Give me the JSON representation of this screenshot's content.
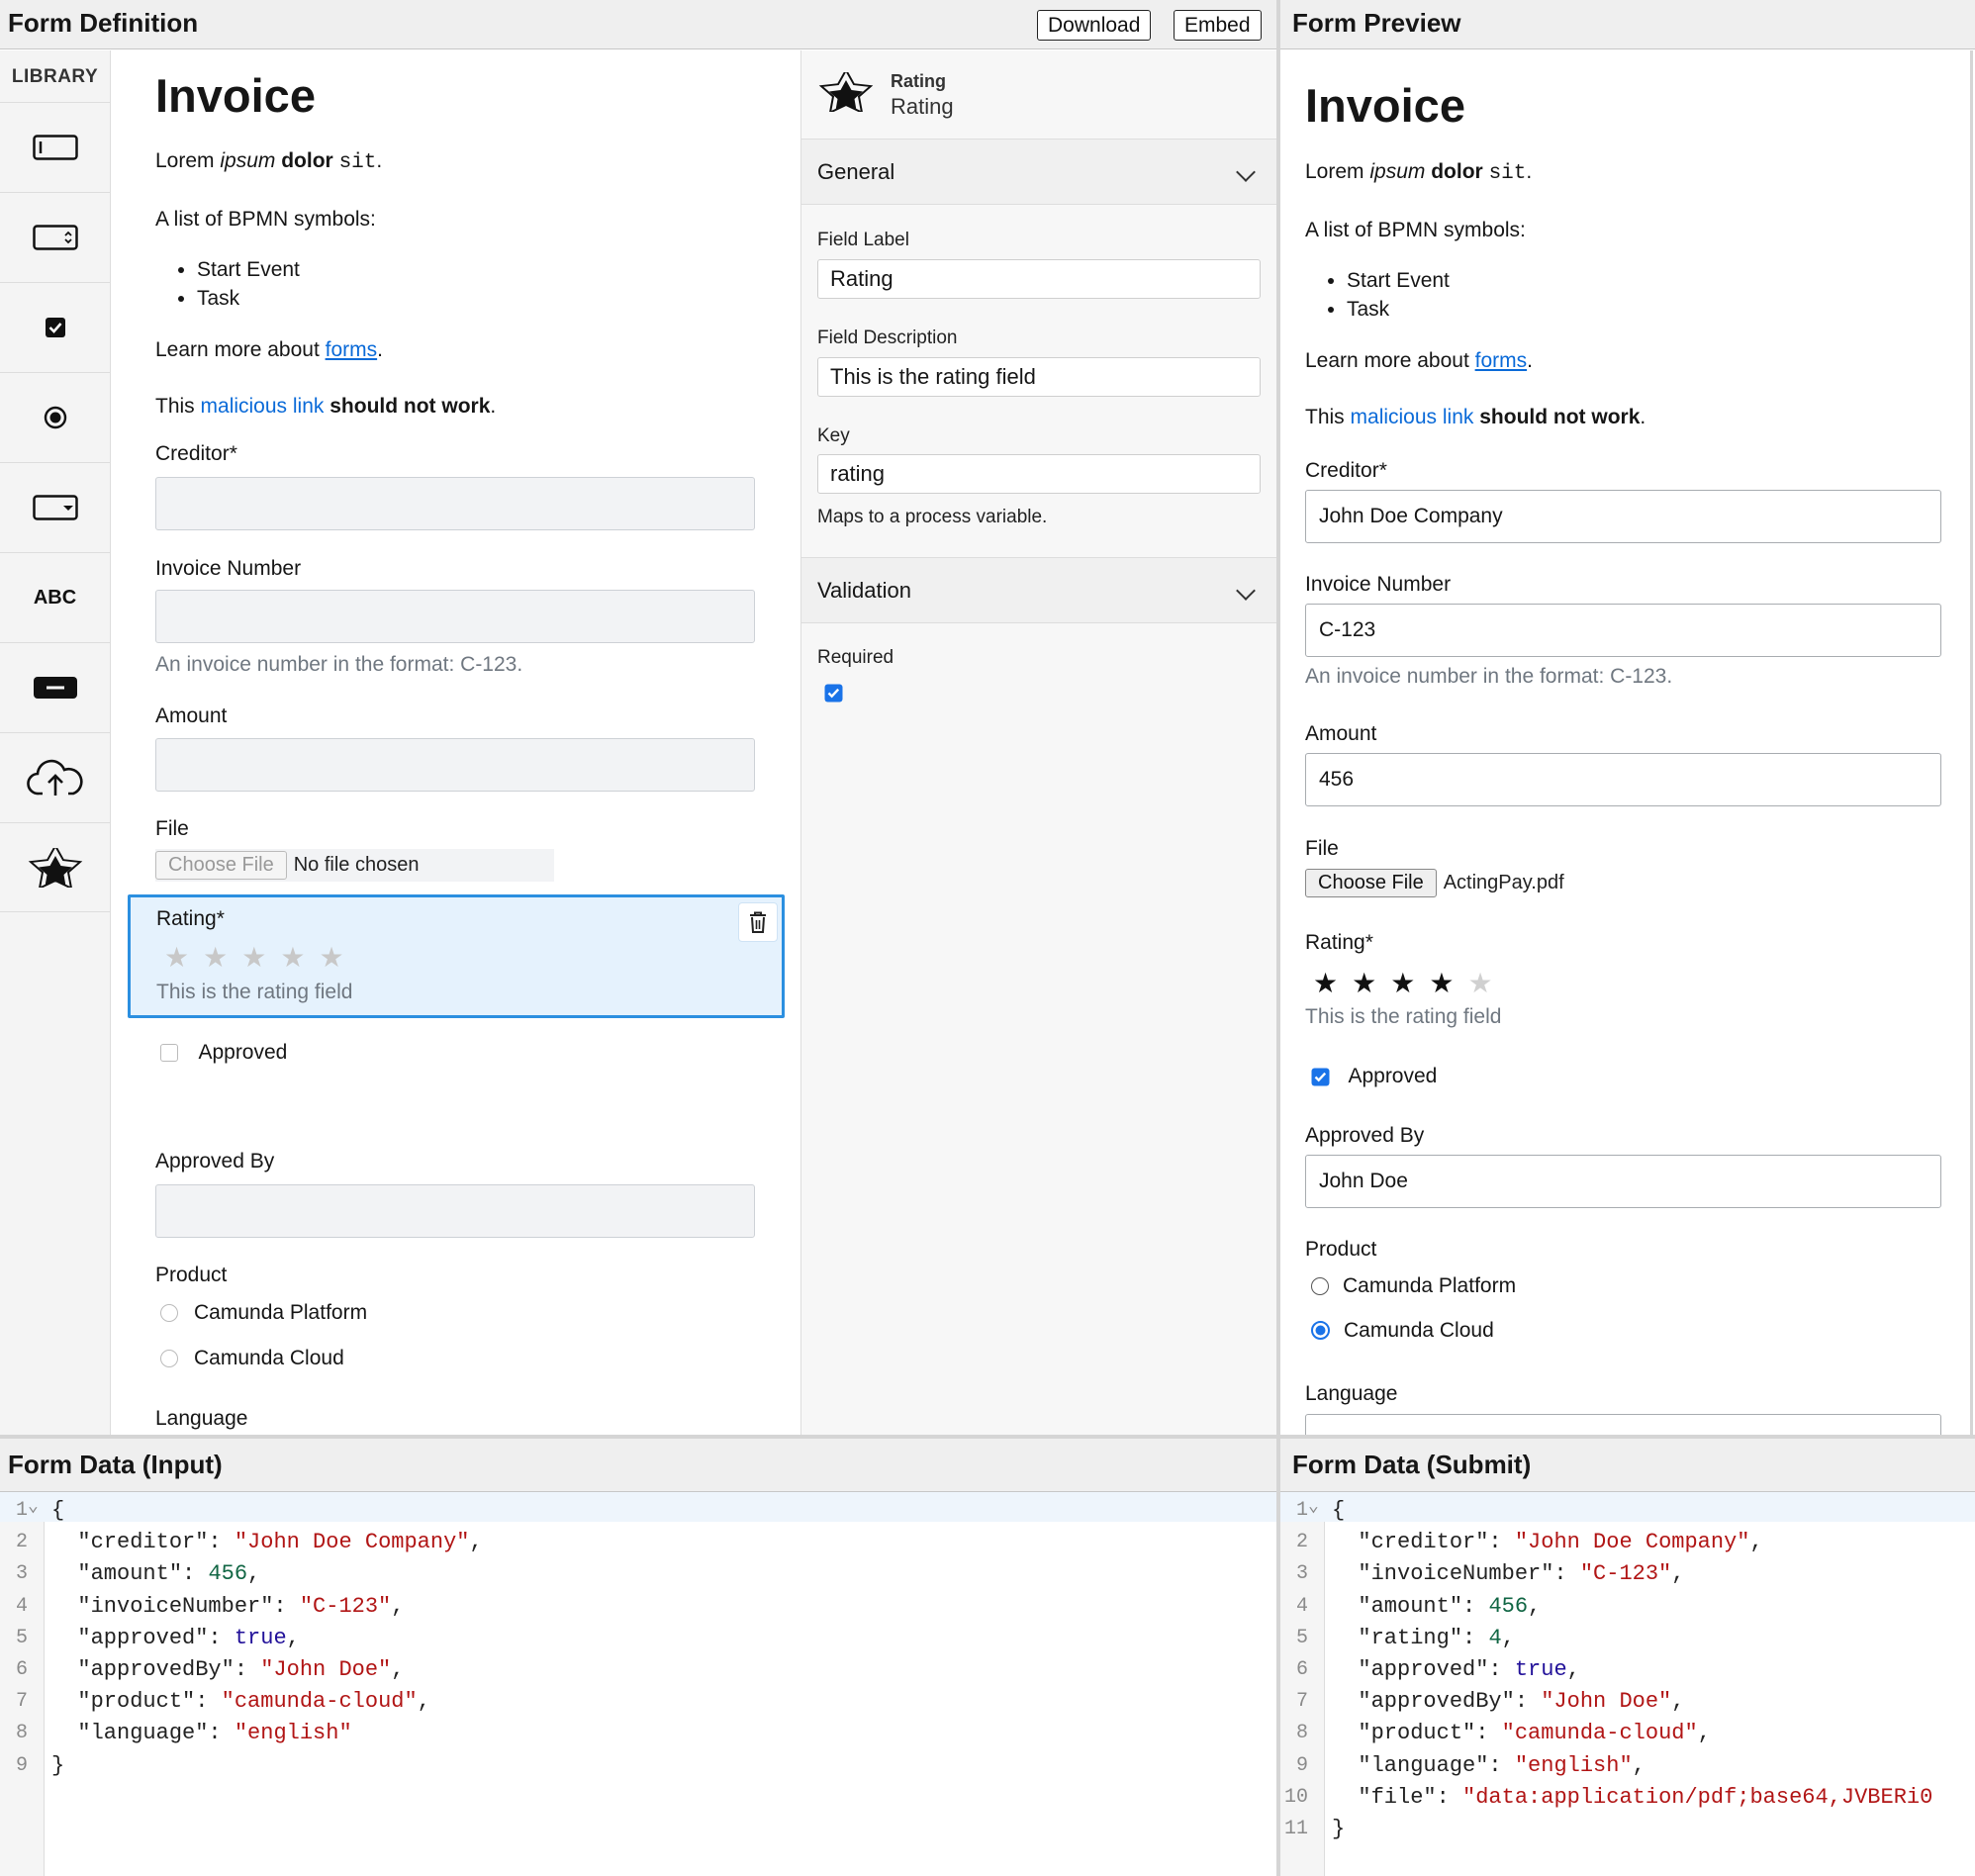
{
  "definition": {
    "title": "Form Definition",
    "download_label": "Download",
    "embed_label": "Embed",
    "library_title": "LIBRARY",
    "library_text_icon": "ABC"
  },
  "form": {
    "title": "Invoice",
    "intro": {
      "p1": "Lorem ",
      "em": "ipsum",
      "p2": " ",
      "b": "dolor",
      "p3": " ",
      "code": "sit",
      "p4": "."
    },
    "list_intro": "A list of BPMN symbols:",
    "list_items": [
      "Start Event",
      "Task"
    ],
    "learn": {
      "prefix": "Learn more about ",
      "link": "forms",
      "suffix": "."
    },
    "malicious": {
      "prefix": "This ",
      "link": "malicious link",
      "mid": " ",
      "bold": "should not work",
      "suffix": "."
    },
    "creditor_label": "Creditor*",
    "invoice_label": "Invoice Number",
    "invoice_desc": "An invoice number in the format: C-123.",
    "amount_label": "Amount",
    "file_label": "File",
    "choose_file": "Choose File",
    "no_file": "No file chosen",
    "rating_label": "Rating*",
    "rating_desc": "This is the rating field",
    "approved_label": "Approved",
    "approved_by_label": "Approved By",
    "product_label": "Product",
    "product_options": [
      "Camunda Platform",
      "Camunda Cloud"
    ],
    "language_label": "Language"
  },
  "properties": {
    "type_label": "Rating",
    "field_name": "Rating",
    "general": "General",
    "field_label_label": "Field Label",
    "field_label_value": "Rating",
    "field_description_label": "Field Description",
    "field_description_value": "This is the rating field",
    "key_label": "Key",
    "key_value": "rating",
    "key_hint": "Maps to a process variable.",
    "validation": "Validation",
    "required_label": "Required",
    "required_checked": true
  },
  "preview": {
    "title": "Form Preview",
    "creditor_value": "John Doe Company",
    "invoice_value": "C-123",
    "amount_value": "456",
    "file_name": "ActingPay.pdf",
    "rating_value": 4,
    "rating_max": 5,
    "approved_checked": true,
    "approved_by_value": "John Doe",
    "product_selected": "Camunda Cloud"
  },
  "input_data": {
    "title": "Form Data (Input)",
    "line_numbers": [
      "1",
      "2",
      "3",
      "4",
      "5",
      "6",
      "7",
      "8",
      "9"
    ],
    "lines": [
      {
        "key": "creditor",
        "value": "\"John Doe Company\"",
        "type": "s"
      },
      {
        "key": "amount",
        "value": "456",
        "type": "n"
      },
      {
        "key": "invoiceNumber",
        "value": "\"C-123\"",
        "type": "s"
      },
      {
        "key": "approved",
        "value": "true",
        "type": "k"
      },
      {
        "key": "approvedBy",
        "value": "\"John Doe\"",
        "type": "s"
      },
      {
        "key": "product",
        "value": "\"camunda-cloud\"",
        "type": "s"
      },
      {
        "key": "language",
        "value": "\"english\"",
        "type": "s"
      }
    ]
  },
  "submit_data": {
    "title": "Form Data (Submit)",
    "line_numbers": [
      "1",
      "2",
      "3",
      "4",
      "5",
      "6",
      "7",
      "8",
      "9",
      "10",
      "11"
    ],
    "lines": [
      {
        "key": "creditor",
        "value": "\"John Doe Company\"",
        "type": "s"
      },
      {
        "key": "invoiceNumber",
        "value": "\"C-123\"",
        "type": "s"
      },
      {
        "key": "amount",
        "value": "456",
        "type": "n"
      },
      {
        "key": "rating",
        "value": "4",
        "type": "n"
      },
      {
        "key": "approved",
        "value": "true",
        "type": "k"
      },
      {
        "key": "approvedBy",
        "value": "\"John Doe\"",
        "type": "s"
      },
      {
        "key": "product",
        "value": "\"camunda-cloud\"",
        "type": "s"
      },
      {
        "key": "language",
        "value": "\"english\"",
        "type": "s"
      },
      {
        "key": "file",
        "value": "\"data:application/pdf;base64,JVBERi0",
        "type": "s"
      }
    ]
  },
  "colors": {
    "accent": "#0a6ad8",
    "selected_border": "#2b8fe0",
    "selected_bg": "#e5f2fd",
    "string": "#b11515",
    "number": "#116644",
    "keyword": "#221199"
  }
}
